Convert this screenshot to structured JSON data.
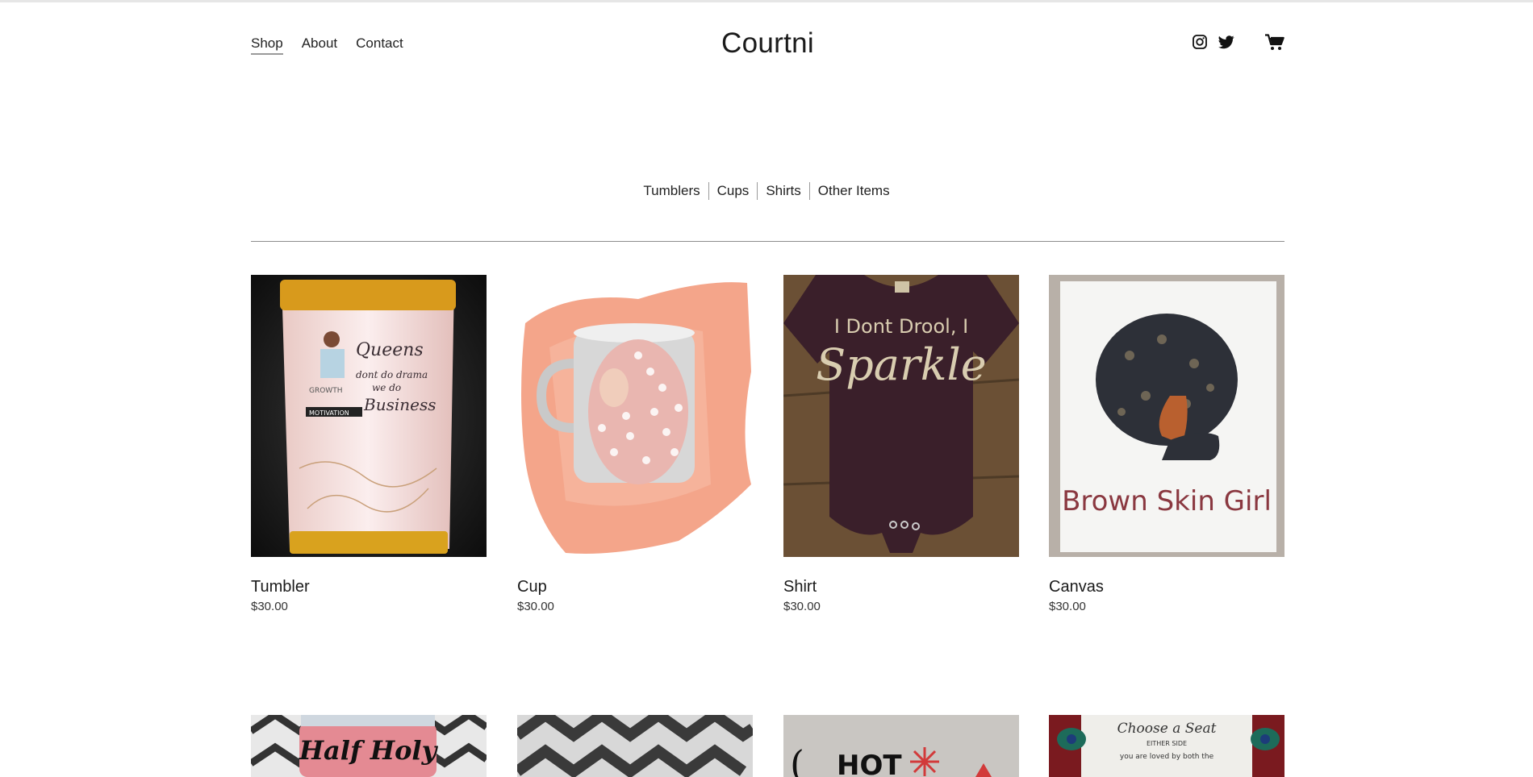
{
  "header": {
    "title": "Courtni",
    "nav": [
      {
        "label": "Shop"
      },
      {
        "label": "About"
      },
      {
        "label": "Contact"
      }
    ]
  },
  "icons": [
    "instagram-icon",
    "twitter-icon",
    "cart-icon"
  ],
  "categories": [
    {
      "label": "Tumblers"
    },
    {
      "label": "Cups"
    },
    {
      "label": "Shirts"
    },
    {
      "label": "Other Items"
    }
  ],
  "products": [
    {
      "name": "Tumbler",
      "price": "$30.00",
      "image_text": [
        "Queens",
        "dont do drama",
        "we do",
        "Business",
        "GROWTH",
        "MOTIVATION"
      ]
    },
    {
      "name": "Cup",
      "price": "$30.00"
    },
    {
      "name": "Shirt",
      "price": "$30.00",
      "image_text": [
        "I Dont Drool, I",
        "Sparkle"
      ]
    },
    {
      "name": "Canvas",
      "price": "$30.00",
      "image_text": [
        "Brown Skin Girl"
      ]
    }
  ],
  "products_row2": [
    {
      "image_text": [
        "Half Holy"
      ]
    },
    {},
    {
      "image_text": [
        "HOT"
      ]
    },
    {
      "image_text": [
        "Choose a Seat",
        "EITHER SIDE",
        "you are loved by both the"
      ]
    }
  ],
  "colors": {
    "text": "#1a1a1a",
    "rule": "#8c8c8c",
    "active_underline": "#9a9a9a"
  }
}
